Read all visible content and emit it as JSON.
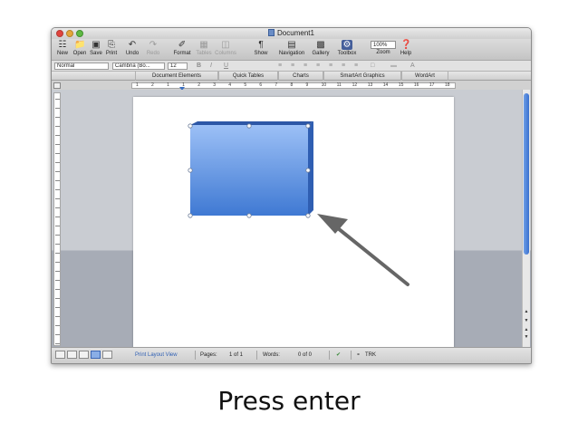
{
  "window": {
    "title": "Document1"
  },
  "toolbar": {
    "new": "New",
    "open": "Open",
    "save": "Save",
    "print": "Print",
    "undo": "Undo",
    "redo": "Redo",
    "format": "Format",
    "tables": "Tables",
    "columns": "Columns",
    "show": "Show",
    "navigation": "Navigation",
    "gallery": "Gallery",
    "toolbox": "Toolbox",
    "zoom": "Zoom",
    "zoom_value": "100%",
    "help": "Help"
  },
  "format_bar": {
    "style": "Normal",
    "font": "Cambria (Bo...",
    "size": "12"
  },
  "ribbon": {
    "tabs": [
      "Document Elements",
      "Quick Tables",
      "Charts",
      "SmartArt Graphics",
      "WordArt"
    ]
  },
  "ruler": {
    "numbers": [
      "1",
      "2",
      "1",
      "1",
      "2",
      "3",
      "4",
      "5",
      "6",
      "7",
      "8",
      "9",
      "10",
      "11",
      "12",
      "13",
      "14",
      "15",
      "16",
      "17",
      "18"
    ]
  },
  "statusbar": {
    "view": "Print Layout View",
    "pages_label": "Pages:",
    "pages_value": "1 of 1",
    "words_label": "Words:",
    "words_value": "0 of 0",
    "trk": "TRK"
  },
  "caption": "Press enter",
  "colors": {
    "shape_top": "#9cc0f6",
    "shape_bottom": "#3f79d3",
    "arrow": "#666666",
    "accent": "#3b6fc1"
  }
}
